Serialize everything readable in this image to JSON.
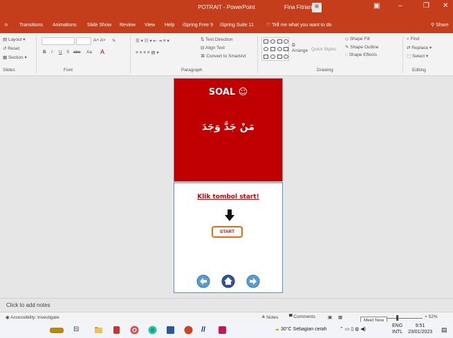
{
  "titlebar": {
    "title": "POTRAIT - PowerPoint",
    "user": "Fina Fitriana"
  },
  "tabs": [
    "n",
    "Transitions",
    "Animations",
    "Slide Show",
    "Review",
    "View",
    "Help",
    "iSpring Free 9",
    "iSpring Suite 11"
  ],
  "tell_me": "Tell me what you want to do",
  "share": "Share",
  "ribbon": {
    "slides": {
      "layout": "Layout",
      "reset": "Reset",
      "section": "Section",
      "label": "Slides"
    },
    "font": {
      "label": "Font",
      "bold": "B",
      "italic": "I",
      "underline": "U",
      "strike": "S",
      "spacing": "abc",
      "aa": "Aa",
      "color": "A"
    },
    "paragraph": {
      "label": "Paragraph",
      "text_direction": "Text Direction",
      "align_text": "Align Text",
      "convert_smartart": "Convert to SmartArt"
    },
    "drawing": {
      "label": "Drawing",
      "arrange": "Arrange",
      "quick_styles": "Quick Styles",
      "shape_fill": "Shape Fill",
      "shape_outline": "Shape Outline",
      "shape_effects": "Shape Effects"
    },
    "editing": {
      "label": "Editing",
      "find": "Find",
      "replace": "Replace",
      "select": "Select"
    }
  },
  "slide": {
    "title": "SOAL ☺",
    "arabic_text": "مَنْ جَدَّ وَجَدَ",
    "prompt": "Klik tombol start!",
    "start_label": "START"
  },
  "notes_placeholder": "Click to add notes",
  "statusbar": {
    "accessibility": "Accessibility: Investigate",
    "notes": "Notes",
    "comments": "Comments",
    "zoom": "52%",
    "tooltip": "Meet Now"
  },
  "taskbar": {
    "weather": "30°C  Sebagian cerah",
    "lang1": "ENG",
    "lang2": "INTL",
    "time": "9:51",
    "date": "23/01/2023"
  }
}
